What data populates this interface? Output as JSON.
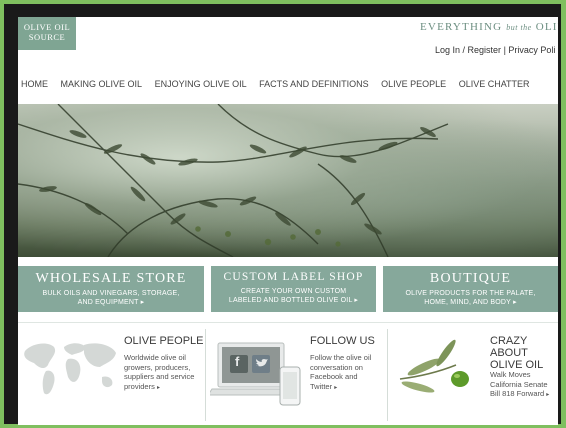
{
  "header": {
    "logo_line1": "OLIVE OIL",
    "logo_line2": "SOURCE",
    "tagline_a": "EVERYTHING",
    "tagline_b": "but the",
    "tagline_c": "OLIVE",
    "login_label": "Log In / Register",
    "divider": "|",
    "privacy_label": "Privacy Poli"
  },
  "nav": {
    "items": [
      "HOME",
      "MAKING OLIVE OIL",
      "ENJOYING OLIVE OIL",
      "FACTS AND DEFINITIONS",
      "OLIVE PEOPLE",
      "OLIVE CHATTER"
    ]
  },
  "panels": [
    {
      "title": "WHOLESALE STORE",
      "line1": "BULK OILS AND VINEGARS, STORAGE,",
      "line2": "AND EQUIPMENT ▸"
    },
    {
      "title": "CUSTOM LABEL SHOP",
      "line1": "CREATE YOUR OWN CUSTOM",
      "line2": "LABELED AND BOTTLED OLIVE OIL ▸"
    },
    {
      "title": "BOUTIQUE",
      "line1": "OLIVE PRODUCTS FOR THE PALATE,",
      "line2": "HOME, MIND, AND BODY ▸"
    }
  ],
  "features": {
    "people": {
      "title": "OLIVE PEOPLE",
      "lines": [
        "Worldwide olive oil",
        "growers, producers,",
        "suppliers and service",
        "providers"
      ],
      "arrow": "▸"
    },
    "follow": {
      "title": "FOLLOW US",
      "lines": [
        "Follow the olive oil",
        "conversation on",
        "Facebook and",
        "Twitter"
      ],
      "arrow": "▸",
      "facebook_glyph": "f"
    },
    "crazy": {
      "title_line1": "CRAZY ABOUT",
      "title_line2": "OLIVE OIL",
      "lines": [
        "Walk Moves",
        "California Senate",
        "Bill 818 Forward"
      ],
      "arrow": "▸"
    }
  },
  "colors": {
    "accent": "#86a89b",
    "outer_border": "#7fbf5f",
    "frame": "#1a1a1a"
  }
}
